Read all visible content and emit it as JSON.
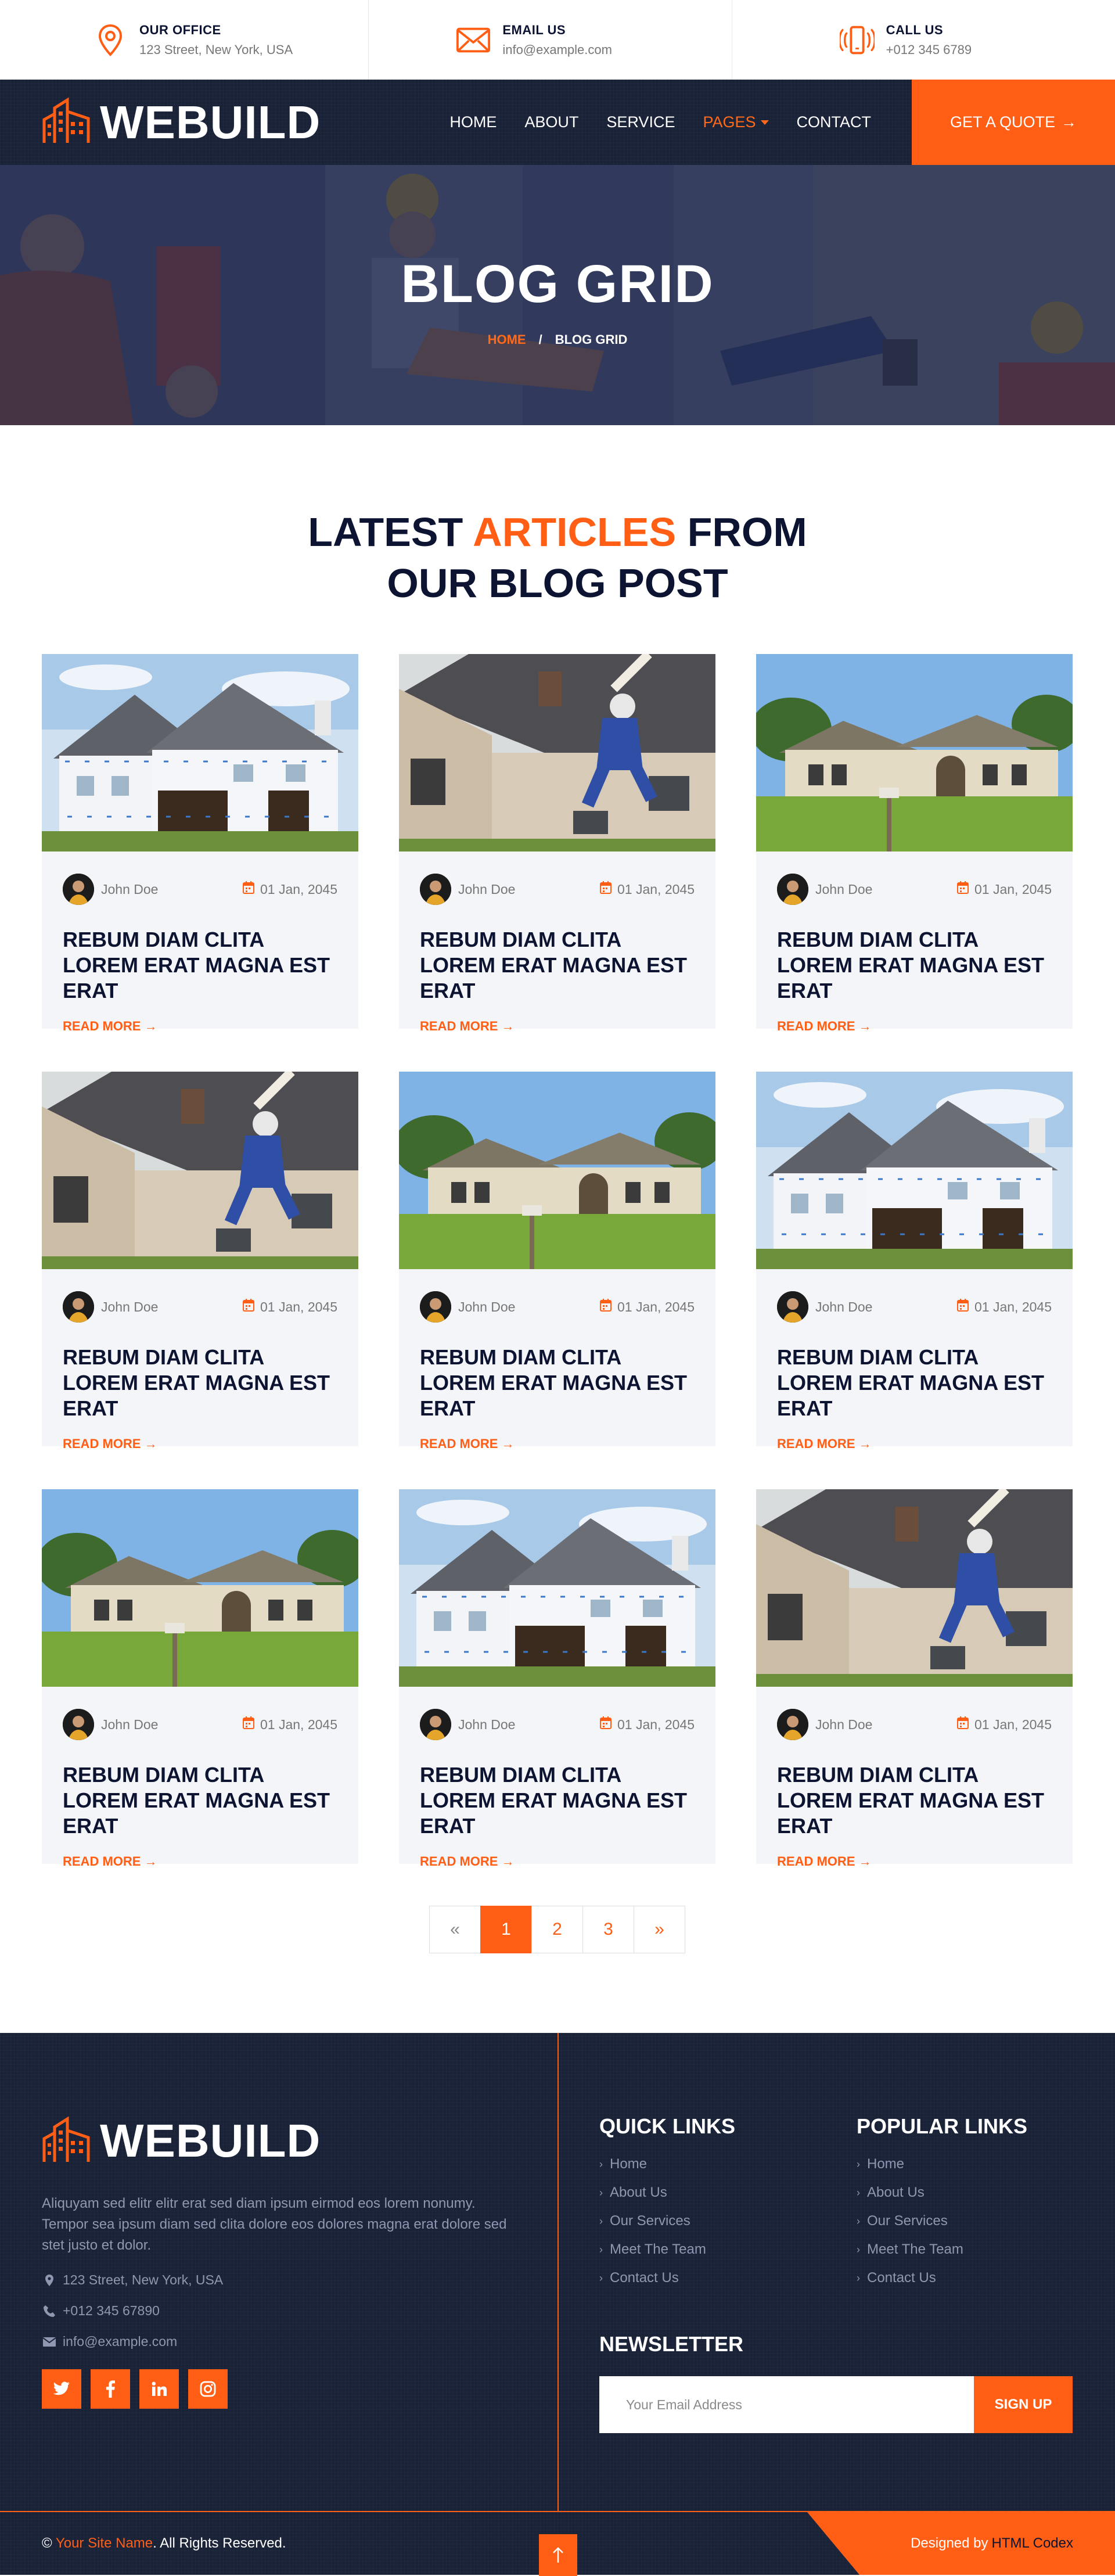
{
  "topbar": {
    "office": {
      "title": "OUR OFFICE",
      "value": "123 Street, New York, USA",
      "icon": "map-pin-icon"
    },
    "email": {
      "title": "EMAIL US",
      "value": "info@example.com",
      "icon": "envelope-icon"
    },
    "call": {
      "title": "CALL US",
      "value": "+012 345 6789",
      "icon": "phone-ringing-icon"
    }
  },
  "brand": {
    "name": "WEBUILD"
  },
  "nav": {
    "items": [
      {
        "label": "HOME"
      },
      {
        "label": "ABOUT"
      },
      {
        "label": "SERVICE"
      },
      {
        "label": "PAGES",
        "active": true
      },
      {
        "label": "CONTACT"
      }
    ],
    "cta": "GET A QUOTE"
  },
  "hero": {
    "title": "BLOG GRID",
    "crumb_home": "HOME",
    "crumb_sep": "/",
    "crumb_current": "BLOG GRID"
  },
  "section": {
    "title_a": "LATEST ",
    "title_highlight": "ARTICLES",
    "title_b": " FROM",
    "title_line2": "OUR BLOG POST"
  },
  "posts": [
    {
      "author": "John Doe",
      "date": "01 Jan, 2045",
      "title": "REBUM DIAM CLITA LOREM ERAT MAGNA EST ERAT",
      "more": "READ MORE"
    },
    {
      "author": "John Doe",
      "date": "01 Jan, 2045",
      "title": "REBUM DIAM CLITA LOREM ERAT MAGNA EST ERAT",
      "more": "READ MORE"
    },
    {
      "author": "John Doe",
      "date": "01 Jan, 2045",
      "title": "REBUM DIAM CLITA LOREM ERAT MAGNA EST ERAT",
      "more": "READ MORE"
    },
    {
      "author": "John Doe",
      "date": "01 Jan, 2045",
      "title": "REBUM DIAM CLITA LOREM ERAT MAGNA EST ERAT",
      "more": "READ MORE"
    },
    {
      "author": "John Doe",
      "date": "01 Jan, 2045",
      "title": "REBUM DIAM CLITA LOREM ERAT MAGNA EST ERAT",
      "more": "READ MORE"
    },
    {
      "author": "John Doe",
      "date": "01 Jan, 2045",
      "title": "REBUM DIAM CLITA LOREM ERAT MAGNA EST ERAT",
      "more": "READ MORE"
    },
    {
      "author": "John Doe",
      "date": "01 Jan, 2045",
      "title": "REBUM DIAM CLITA LOREM ERAT MAGNA EST ERAT",
      "more": "READ MORE"
    },
    {
      "author": "John Doe",
      "date": "01 Jan, 2045",
      "title": "REBUM DIAM CLITA LOREM ERAT MAGNA EST ERAT",
      "more": "READ MORE"
    },
    {
      "author": "John Doe",
      "date": "01 Jan, 2045",
      "title": "REBUM DIAM CLITA LOREM ERAT MAGNA EST ERAT",
      "more": "READ MORE"
    }
  ],
  "pagination": {
    "prev": "«",
    "pages": [
      "1",
      "2",
      "3"
    ],
    "current": "1",
    "next": "»"
  },
  "footer": {
    "about": "Aliquyam sed elitr elitr erat sed diam ipsum eirmod eos lorem nonumy. Tempor sea ipsum diam sed clita dolore eos dolores magna erat dolore sed stet justo et dolor.",
    "address": "123 Street, New York, USA",
    "phone": "+012 345 67890",
    "email": "info@example.com",
    "socials": [
      "twitter-icon",
      "facebook-icon",
      "linkedin-icon",
      "instagram-icon"
    ],
    "quick_title": "QUICK LINKS",
    "quick_links": [
      "Home",
      "About Us",
      "Our Services",
      "Meet The Team",
      "Contact Us"
    ],
    "popular_title": "POPULAR LINKS",
    "popular_links": [
      "Home",
      "About Us",
      "Our Services",
      "Meet The Team",
      "Contact Us"
    ],
    "newsletter_title": "NEWSLETTER",
    "newsletter_placeholder": "Your Email Address",
    "newsletter_button": "SIGN UP"
  },
  "copyright": {
    "symbol": "©",
    "site": "Your Site Name",
    "rights": ". All Rights Reserved.",
    "designed_by": "Designed by",
    "designer": "HTML Codex"
  },
  "colors": {
    "accent": "#FF5E14",
    "dark": "#0C1432",
    "navy": "#1a2238",
    "card_bg": "#F4F5F8"
  }
}
